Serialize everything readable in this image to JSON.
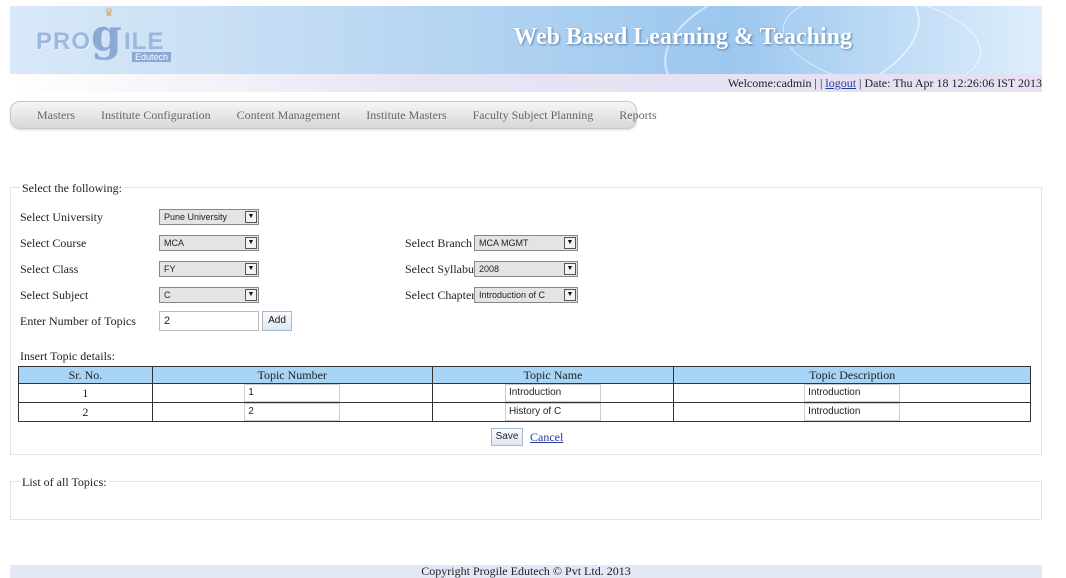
{
  "header": {
    "logo_pro": "PRO",
    "logo_g": "g",
    "logo_ile": "ILE",
    "logo_edutech": "Edutech",
    "site_title": "Web Based Learning & Teaching"
  },
  "welcome": {
    "prefix": "Welcome:cadmin | | ",
    "logout": "logout",
    "date": " | Date: Thu Apr 18 12:26:06 IST 2013"
  },
  "menu": {
    "items": [
      "Masters",
      "Institute Configuration",
      "Content Management",
      "Institute Masters",
      "Faculty Subject Planning",
      "Reports"
    ]
  },
  "form": {
    "legend": "Select the following:",
    "university": {
      "label": "Select University",
      "value": "Pune University"
    },
    "course": {
      "label": "Select Course",
      "value": "MCA"
    },
    "class": {
      "label": "Select Class",
      "value": "FY"
    },
    "subject": {
      "label": "Select Subject",
      "value": "C"
    },
    "topics_count": {
      "label": "Enter Number of Topics",
      "value": "2"
    },
    "add_label": "Add",
    "branch": {
      "label": "Select Branch",
      "value": "MCA MGMT"
    },
    "syllabus": {
      "label": "Select Syllabus",
      "value": "2008"
    },
    "chapter": {
      "label": "Select Chapter",
      "value": "Introduction of C"
    },
    "insert_label": "Insert Topic details:"
  },
  "table": {
    "headers": [
      "Sr. No.",
      "Topic Number",
      "Topic Name",
      "Topic Description"
    ],
    "rows": [
      {
        "sr": "1",
        "number": "1",
        "name": "Introduction",
        "description": "Introduction"
      },
      {
        "sr": "2",
        "number": "2",
        "name": "History of C",
        "description": "Introduction"
      }
    ]
  },
  "actions": {
    "save": "Save",
    "cancel": "Cancel"
  },
  "list": {
    "legend": "List of all Topics:"
  },
  "footer": {
    "copyright": "Copyright Progile Edutech © Pvt Ltd. 2013"
  },
  "colors": {
    "table_header": "#a8d4f5",
    "link": "#223a9c"
  }
}
